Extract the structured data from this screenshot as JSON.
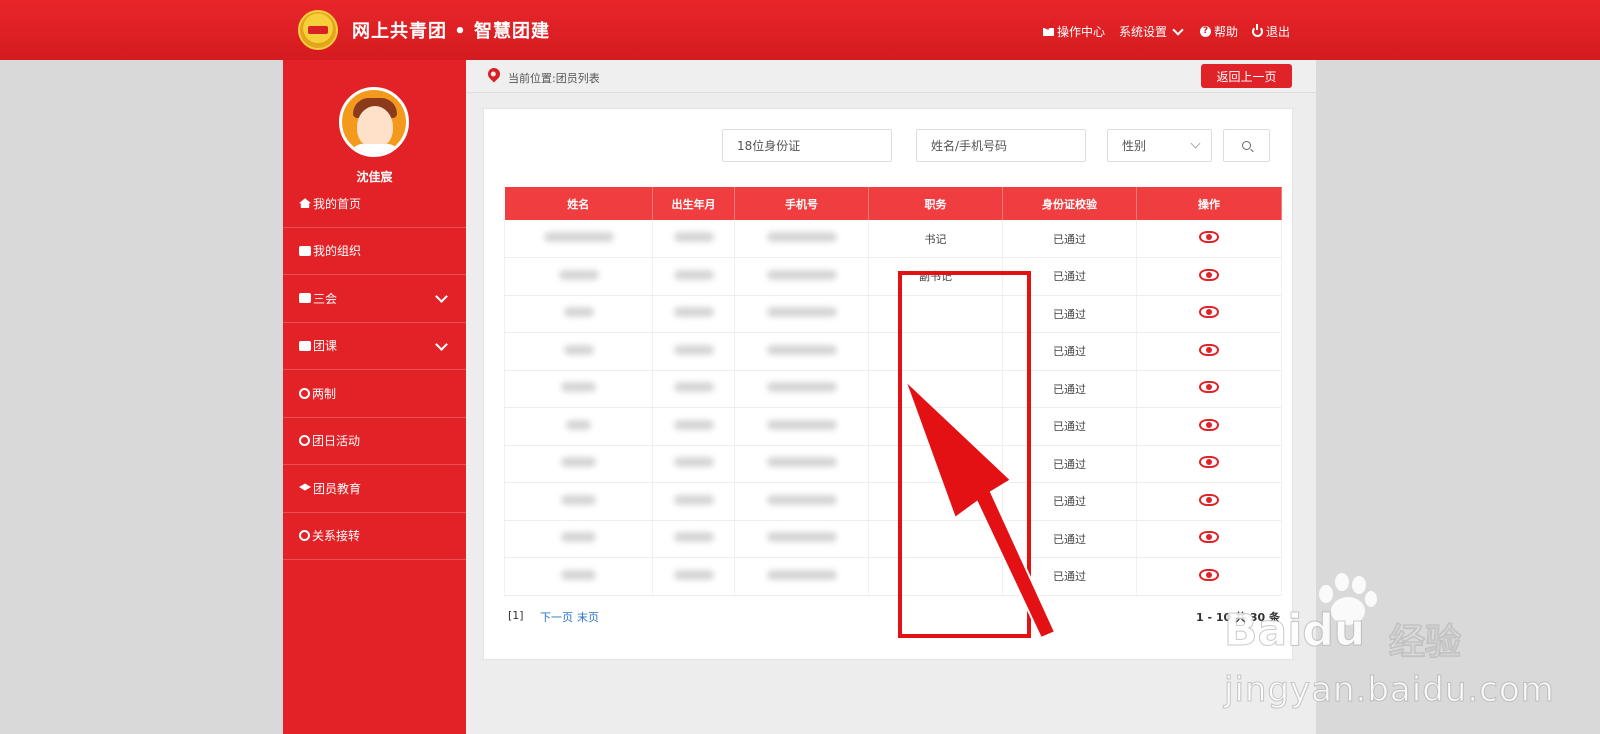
{
  "header": {
    "brand": "网上共青团 • 智慧团建",
    "nav": {
      "ops": "操作中心",
      "settings": "系统设置",
      "help": "帮助",
      "logout": "退出"
    }
  },
  "sidebar": {
    "username": "沈佳宸",
    "items": [
      {
        "label": "我的首页",
        "icon": "home-icon"
      },
      {
        "label": "我的组织",
        "icon": "users-icon"
      },
      {
        "label": "三会",
        "icon": "edit-icon",
        "expandable": true
      },
      {
        "label": "团课",
        "icon": "folder-icon",
        "expandable": true
      },
      {
        "label": "两制",
        "icon": "target-icon"
      },
      {
        "label": "团日活动",
        "icon": "recycle-icon"
      },
      {
        "label": "团员教育",
        "icon": "graduation-cap-icon"
      },
      {
        "label": "关系接转",
        "icon": "refresh-icon"
      }
    ]
  },
  "breadcrumb": "当前位置:团员列表",
  "back_button": "返回上一页",
  "filters": {
    "id_placeholder": "18位身份证",
    "name_placeholder": "姓名/手机号码",
    "gender": "性别"
  },
  "table": {
    "columns": [
      "姓名",
      "出生年月",
      "手机号",
      "职务",
      "身份证校验",
      "操作"
    ],
    "rows": [
      {
        "position": "书记",
        "check": "已通过"
      },
      {
        "position": "副书记",
        "check": "已通过"
      },
      {
        "position": "",
        "check": "已通过"
      },
      {
        "position": "",
        "check": "已通过"
      },
      {
        "position": "",
        "check": "已通过"
      },
      {
        "position": "",
        "check": "已通过"
      },
      {
        "position": "",
        "check": "已通过"
      },
      {
        "position": "",
        "check": "已通过"
      },
      {
        "position": "",
        "check": "已通过"
      },
      {
        "position": "",
        "check": "已通过"
      }
    ]
  },
  "pager": {
    "current": "[1]",
    "next": "下一页",
    "last": "末页",
    "info": "1 - 10 共 30 条"
  },
  "watermark": {
    "brand": "Baidu",
    "cn": "经验",
    "url": "jingyan.baidu.com"
  },
  "colors": {
    "primary": "#e22226",
    "header_cell": "#f03e40",
    "annotation": "#e31014"
  }
}
